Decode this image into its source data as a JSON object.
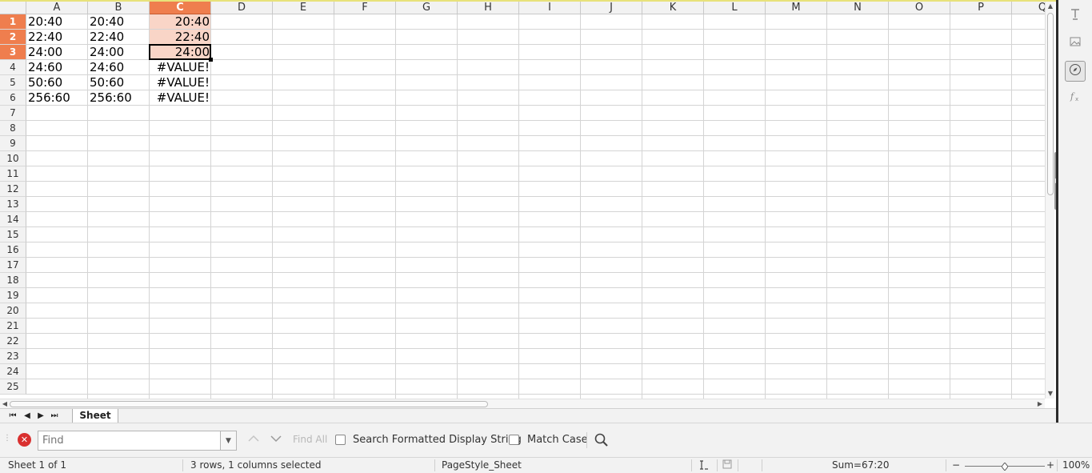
{
  "columns": [
    "A",
    "B",
    "C",
    "D",
    "E",
    "F",
    "G",
    "H",
    "I",
    "J",
    "K",
    "L",
    "M",
    "N",
    "O",
    "P",
    "Q"
  ],
  "selected_column": "C",
  "rows": [
    "1",
    "2",
    "3",
    "4",
    "5",
    "6",
    "7",
    "8",
    "9",
    "10",
    "11",
    "12",
    "13",
    "14",
    "15",
    "16",
    "17",
    "18",
    "19",
    "20",
    "21",
    "22",
    "23",
    "24",
    "25"
  ],
  "selected_rows": [
    "1",
    "2",
    "3"
  ],
  "cells": [
    {
      "ref": "A1",
      "value": "20:40"
    },
    {
      "ref": "B1",
      "value": "20:40"
    },
    {
      "ref": "C1",
      "value": "20:40"
    },
    {
      "ref": "A2",
      "value": "22:40"
    },
    {
      "ref": "B2",
      "value": "22:40"
    },
    {
      "ref": "C2",
      "value": "22:40"
    },
    {
      "ref": "A3",
      "value": "24:00"
    },
    {
      "ref": "B3",
      "value": "24:00"
    },
    {
      "ref": "C3",
      "value": "24:00"
    },
    {
      "ref": "A4",
      "value": "24:60"
    },
    {
      "ref": "B4",
      "value": "24:60"
    },
    {
      "ref": "C4",
      "value": "#VALUE!"
    },
    {
      "ref": "A5",
      "value": "50:60"
    },
    {
      "ref": "B5",
      "value": "50:60"
    },
    {
      "ref": "C5",
      "value": "#VALUE!"
    },
    {
      "ref": "A6",
      "value": "256:60"
    },
    {
      "ref": "B6",
      "value": "256:60"
    },
    {
      "ref": "C6",
      "value": "#VALUE!"
    }
  ],
  "right_aligned_columns": [
    "C"
  ],
  "selection_range": [
    "C1",
    "C2",
    "C3"
  ],
  "cursor_cell": "C3",
  "sheet_tab": {
    "label": "Sheet"
  },
  "find_toolbar": {
    "placeholder": "Find",
    "find_all_label": "Find All",
    "search_formatted_label": "Search Formatted Display String",
    "search_formatted_checked": false,
    "match_case_label": "Match Case",
    "match_case_checked": false
  },
  "status": {
    "sheet_info": "Sheet 1 of 1",
    "selection_info": "3 rows, 1 columns selected",
    "page_style": "PageStyle_Sheet",
    "sum": "Sum=67:20",
    "zoom": "100%",
    "zoom_fraction": 0.5
  },
  "icons": {
    "close_find": "close-icon",
    "find_options": "magnifier-icon",
    "sidebar": [
      "properties-icon",
      "gallery-icon",
      "navigator-icon",
      "functions-icon"
    ]
  },
  "colors": {
    "header_selected": "#ef7e4e",
    "selection_fill": "#f9d5c7",
    "close_red": "#d9302f"
  }
}
